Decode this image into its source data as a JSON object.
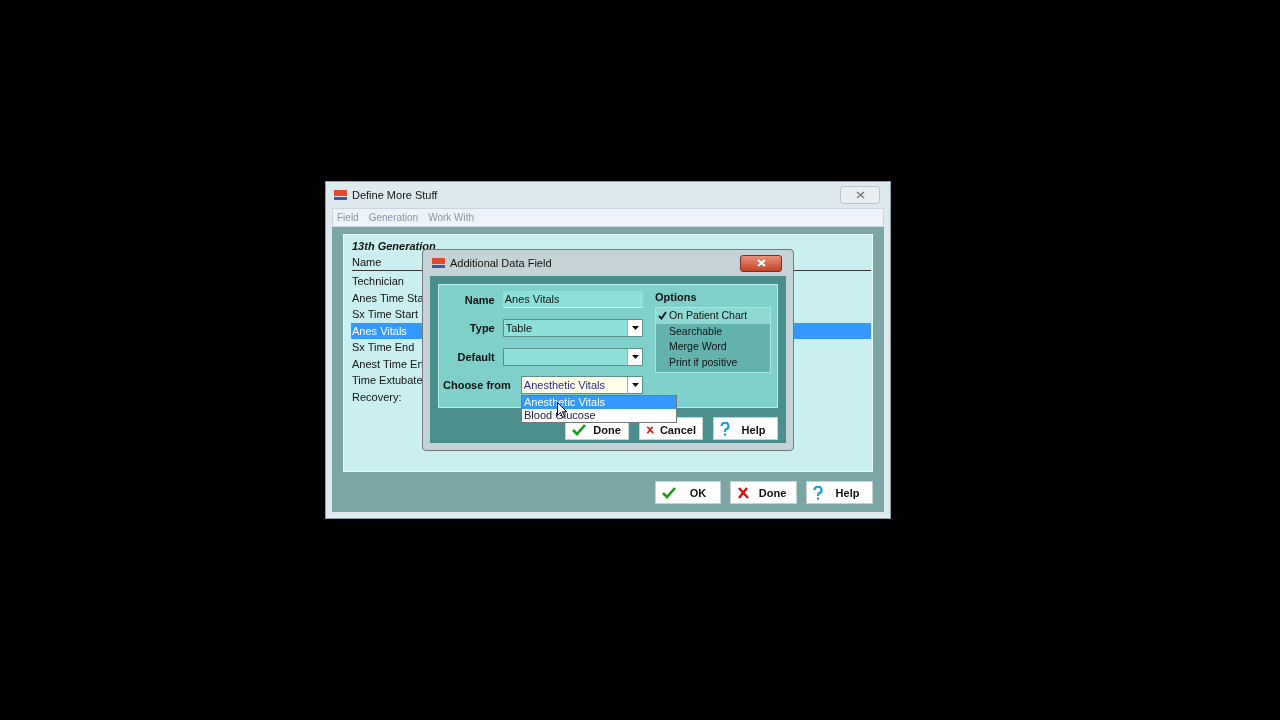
{
  "main_window": {
    "title": "Define More Stuff",
    "menu": [
      "Field",
      "Generation",
      "Work With"
    ],
    "group_title": "13th Generation",
    "list_header": "Name",
    "items": [
      {
        "label": "Technician",
        "selected": false
      },
      {
        "label": "Anes Time Sta",
        "selected": false
      },
      {
        "label": "Sx Time Start",
        "selected": false
      },
      {
        "label": "Anes Vitals",
        "selected": true
      },
      {
        "label": "Sx Time End",
        "selected": false
      },
      {
        "label": "Anest Time En",
        "selected": false
      },
      {
        "label": "Time Extubate",
        "selected": false
      },
      {
        "label": "Recovery:",
        "selected": false
      }
    ],
    "buttons": [
      {
        "label": "OK",
        "kind": "ok"
      },
      {
        "label": "Done",
        "kind": "cancel"
      },
      {
        "label": "Help",
        "kind": "help"
      }
    ]
  },
  "dialog": {
    "title": "Additional Data Field",
    "fields": [
      {
        "label": "Name",
        "value": "Anes Vitals",
        "kind": "text"
      },
      {
        "label": "Type",
        "value": "Table",
        "kind": "select"
      },
      {
        "label": "Default",
        "kind": "select"
      }
    ],
    "choose_from": {
      "label": "Choose from",
      "value": "Anesthetic Vitals",
      "options": [
        {
          "label": "Anesthetic Vitals",
          "selected": true
        },
        {
          "label": "Blood Glucose",
          "selected": false
        }
      ]
    },
    "options_title": "Options",
    "options": [
      {
        "label": "On Patient Chart",
        "checked": true
      },
      {
        "label": "Searchable",
        "checked": false
      },
      {
        "label": "Merge Word",
        "checked": false
      },
      {
        "label": "Print if positive",
        "checked": false
      }
    ],
    "buttons": [
      {
        "label": "Done",
        "kind": "ok"
      },
      {
        "label": "Cancel",
        "kind": "cancel"
      },
      {
        "label": "Help",
        "kind": "help"
      }
    ]
  }
}
